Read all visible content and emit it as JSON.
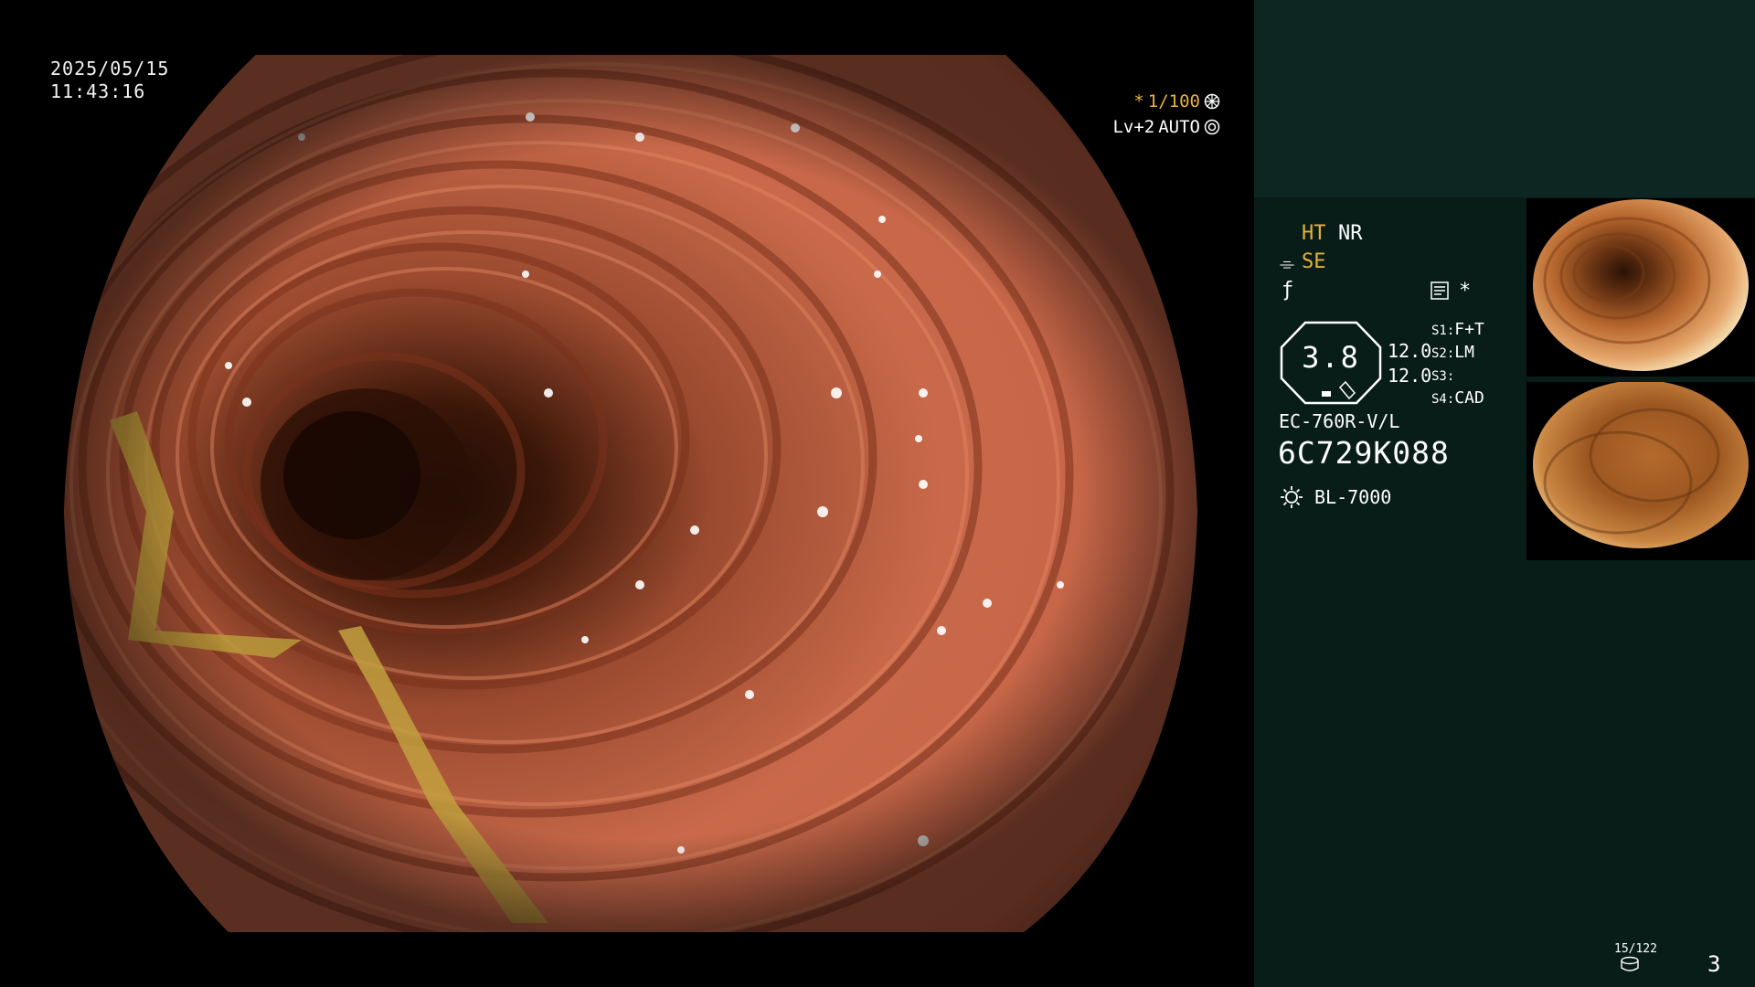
{
  "overlay": {
    "date": "2025/05/15",
    "time": "11:43:16",
    "shutter_marker": "*",
    "shutter": "1/100",
    "level": "Lv+2",
    "iris": "AUTO",
    "shutter_icon": "aperture-icon",
    "iris_icon": "iris-icon"
  },
  "panel": {
    "ht": "HT",
    "nr": "NR",
    "se": "SE",
    "enhance_icon": "structure-enhance-icon",
    "color_icon": "color-mode-icon",
    "memo_icon": "memo-icon",
    "star": "*",
    "gauge_value": "3.8",
    "value_1": "12.0",
    "value_2": "12.0",
    "switches": [
      {
        "key": "S1:",
        "value": "F+T"
      },
      {
        "key": "S2:",
        "value": "LM"
      },
      {
        "key": "S3:",
        "value": ""
      },
      {
        "key": "S4:",
        "value": "CAD"
      }
    ],
    "scope_model": "EC-760R-V/L",
    "scope_serial": "6C729K088",
    "lamp_icon": "lamp-icon",
    "lamp_model": "BL-7000",
    "counter": "15/122",
    "disk_icon": "storage-disk-icon",
    "page_number": "3"
  },
  "colors": {
    "panel_bg": "#081c18",
    "panel_top_bg": "#0d2622",
    "accent_yellow": "#e6b235",
    "mucosa": "#c9694a"
  }
}
